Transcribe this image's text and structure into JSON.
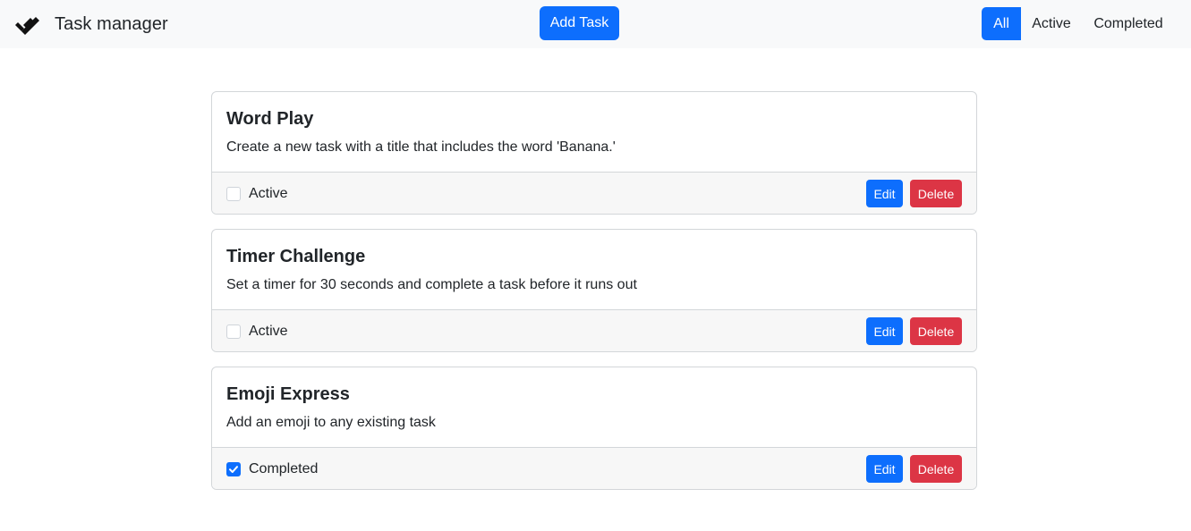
{
  "app": {
    "title": "Task manager",
    "brand_icon": "double-check-icon",
    "add_task_label": "Add Task"
  },
  "filters": {
    "all": "All",
    "active": "Active",
    "completed": "Completed",
    "selected": "All"
  },
  "tasks": [
    {
      "title": "Word Play",
      "description": "Create a new task with a title that includes the word 'Banana.'",
      "status": "Active",
      "completed": false,
      "edit_label": "Edit",
      "delete_label": "Delete"
    },
    {
      "title": "Timer Challenge",
      "description": "Set a timer for 30 seconds and complete a task before it runs out",
      "status": "Active",
      "completed": false,
      "edit_label": "Edit",
      "delete_label": "Delete"
    },
    {
      "title": "Emoji Express",
      "description": "Add an emoji to any existing task",
      "status": "Completed",
      "completed": true,
      "edit_label": "Edit",
      "delete_label": "Delete"
    }
  ],
  "colors": {
    "primary": "#0d6efd",
    "danger": "#dc3545",
    "navbar_bg": "#f8f9fa"
  }
}
